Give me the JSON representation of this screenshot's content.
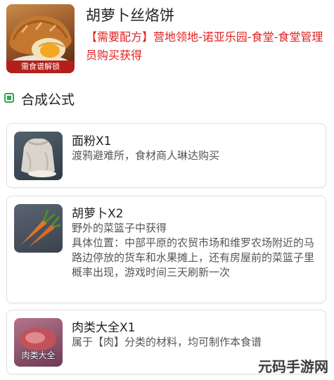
{
  "recipe": {
    "title": "胡萝卜丝烙饼",
    "badge": "需食谱解锁",
    "requirement_tag": "【需要配方】",
    "requirement_text": "营地领地-诺亚乐园-食堂-食堂管理员购买获得"
  },
  "section": {
    "title": "合成公式"
  },
  "ingredients": [
    {
      "name": "面粉X1",
      "icon": "flour-sack-icon",
      "source": "渡鸦避难所，食材商人琳达购买"
    },
    {
      "name": "胡萝卜X2",
      "icon": "carrot-icon",
      "source": "野外的菜篮子中获得\n具体位置：中部平原的农贸市场和维罗农场附近的马路边停放的货车和水果摊上，还有房屋前的菜篮子里概率出现，游戏时间三天刷新一次"
    },
    {
      "name": "肉类大全X1",
      "icon": "meat-icon",
      "thumb_label": "肉类大全",
      "source": "属于【肉】分类的材料，均可制作本食谱"
    }
  ],
  "watermark": "元码手游网",
  "colors": {
    "accent_red": "#e02020",
    "badge_red": "#b3201a",
    "section_green": "#2fa84f"
  }
}
